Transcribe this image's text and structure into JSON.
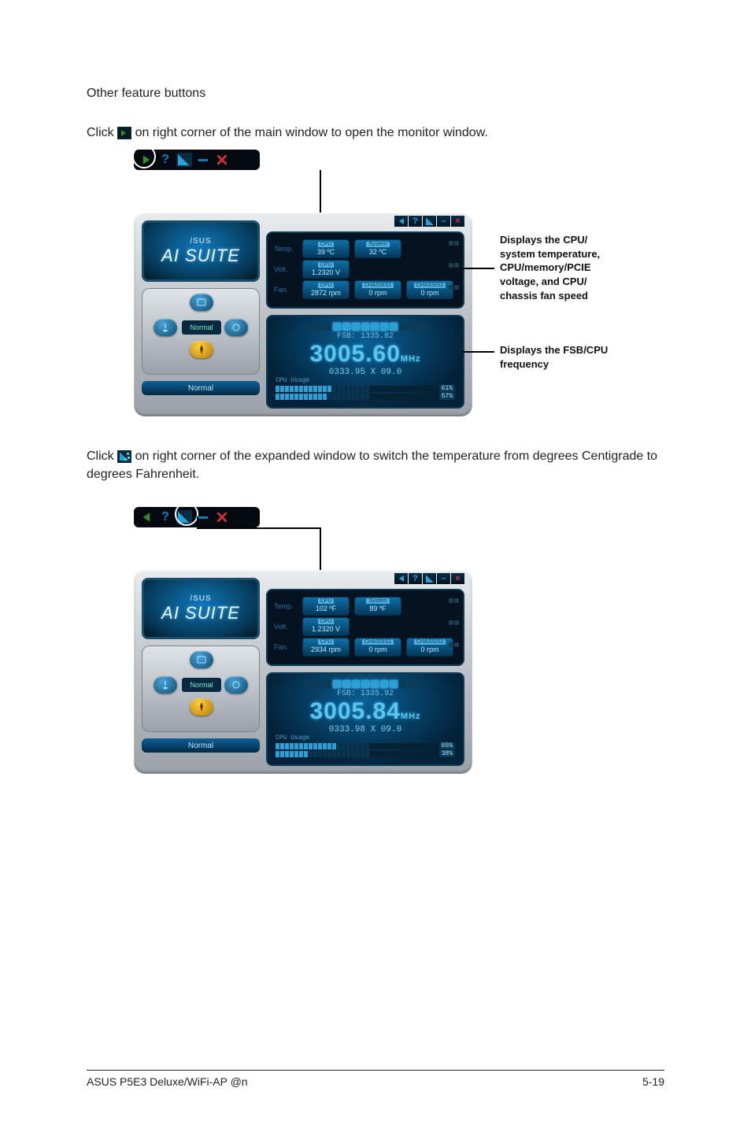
{
  "heading": "Other feature buttons",
  "para1_pre": "Click ",
  "para1_post": " on right corner of the main window to open the monitor window.",
  "para2_pre": "Click ",
  "para2_post": " on right corner of the expanded window to switch the temperature from degrees Centigrade to degrees Fahrenheit.",
  "callout_monitor": "Displays the CPU/\nsystem temperature,\nCPU/memory/PCIE\nvoltage, and CPU/\nchassis fan speed",
  "callout_freq": "Displays the FSB/CPU\nfrequency",
  "logo_brand": "/SUS",
  "logo_title": "AI SUITE",
  "status_normal": "Normal",
  "cp_center": "Normal",
  "topbar": {
    "back": "<",
    "help": "?",
    "cf": "°C/°F",
    "min": "–",
    "close": "×"
  },
  "fig1": {
    "temp_cpu_label": "CPU",
    "temp_cpu_val": "39 ºC",
    "temp_sys_label": "System",
    "temp_sys_val": "32 ºC",
    "volt_cpu_label": "CPU",
    "volt_cpu_val": "1.2320 V",
    "fan_cpu_label": "CPU",
    "fan_cpu_val": "2872 rpm",
    "fan_ch1_label": "CHASSIS1",
    "fan_ch1_val": "0 rpm",
    "fan_ch2_label": "CHASSIS2",
    "fan_ch2_val": "0 rpm",
    "row_temp": "Temp.",
    "row_volt": "Volt.",
    "row_fan": "Fan.",
    "fsb": "FSB: 1335.82",
    "big": "3005.60",
    "unit": "MHz",
    "sub": "0333.95 X 09.0",
    "usage_label": "CPU Usage",
    "u1": "61%",
    "u2": "57%"
  },
  "fig2": {
    "temp_cpu_label": "CPU",
    "temp_cpu_val": "102 ºF",
    "temp_sys_label": "System",
    "temp_sys_val": "89 ºF",
    "volt_cpu_label": "CPU",
    "volt_cpu_val": "1.2320 V",
    "fan_cpu_label": "CPU",
    "fan_cpu_val": "2934 rpm",
    "fan_ch1_label": "CHASSIS1",
    "fan_ch1_val": "0 rpm",
    "fan_ch2_label": "CHASSIS2",
    "fan_ch2_val": "0 rpm",
    "row_temp": "Temp.",
    "row_volt": "Volt.",
    "row_fan": "Fan.",
    "fsb": "FSB: 1335.92",
    "big": "3005.84",
    "unit": "MHz",
    "sub": "0333.98 X 09.0",
    "usage_label": "CPU Usage",
    "u1": "65%",
    "u2": "38%"
  },
  "footer_left": "ASUS P5E3 Deluxe/WiFi-AP @n",
  "footer_right": "5-19"
}
